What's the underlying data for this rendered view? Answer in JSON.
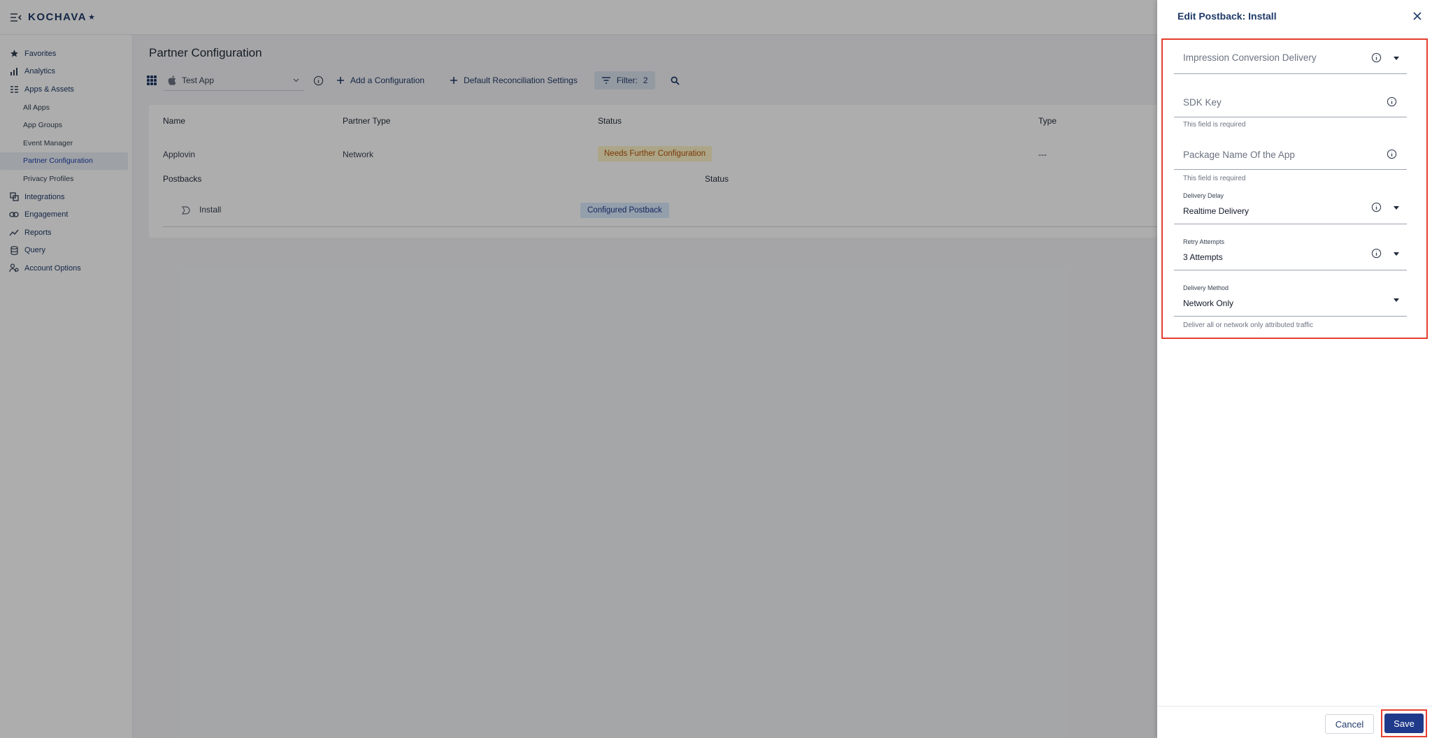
{
  "brand": {
    "name": "KOCHAVA",
    "star": "★"
  },
  "sidebar": {
    "items": [
      {
        "label": "Favorites",
        "icon": "star-icon"
      },
      {
        "label": "Analytics",
        "icon": "bar-chart-icon"
      },
      {
        "label": "Apps & Assets",
        "icon": "apps-icon"
      },
      {
        "label": "All Apps",
        "sub": true
      },
      {
        "label": "App Groups",
        "sub": true
      },
      {
        "label": "Event Manager",
        "sub": true
      },
      {
        "label": "Partner Configuration",
        "sub": true,
        "active": true
      },
      {
        "label": "Privacy Profiles",
        "sub": true
      },
      {
        "label": "Integrations",
        "icon": "integrations-icon"
      },
      {
        "label": "Engagement",
        "icon": "link-icon"
      },
      {
        "label": "Reports",
        "icon": "trend-icon"
      },
      {
        "label": "Query",
        "icon": "database-icon"
      },
      {
        "label": "Account Options",
        "icon": "people-icon"
      }
    ]
  },
  "main": {
    "title": "Partner Configuration",
    "toolbar": {
      "app": "Test App",
      "add_config": "Add a Configuration",
      "default_recon": "Default Reconciliation Settings",
      "filter": "Filter:",
      "filter_count": "2"
    },
    "table": {
      "headers": {
        "name": "Name",
        "partner_type": "Partner Type",
        "status": "Status",
        "type": "Type"
      },
      "row": {
        "name": "Applovin",
        "partner_type": "Network",
        "status": "Needs Further Configuration",
        "type": "---"
      },
      "postbacks_label": "Postbacks",
      "postbacks_status_header": "Status",
      "postback": {
        "name": "Install",
        "status": "Configured Postback"
      }
    }
  },
  "panel": {
    "title": "Edit Postback: Install",
    "fields": {
      "impression": {
        "placeholder": "Impression Conversion Delivery"
      },
      "sdk_key": {
        "placeholder": "SDK Key",
        "helper": "This field is required"
      },
      "package_name": {
        "placeholder": "Package Name Of the App",
        "helper": "This field is required"
      },
      "delivery_delay": {
        "label": "Delivery Delay",
        "value": "Realtime Delivery"
      },
      "retry_attempts": {
        "label": "Retry Attempts",
        "value": "3 Attempts"
      },
      "delivery_method": {
        "label": "Delivery Method",
        "value": "Network Only",
        "helper": "Deliver all or network only attributed traffic"
      }
    },
    "cancel": "Cancel",
    "save": "Save"
  },
  "colors": {
    "accent": "#1f3a8a",
    "highlight": "#e53e2e",
    "warn_bg": "#fef3c7",
    "ok_bg": "#dbeafe"
  }
}
